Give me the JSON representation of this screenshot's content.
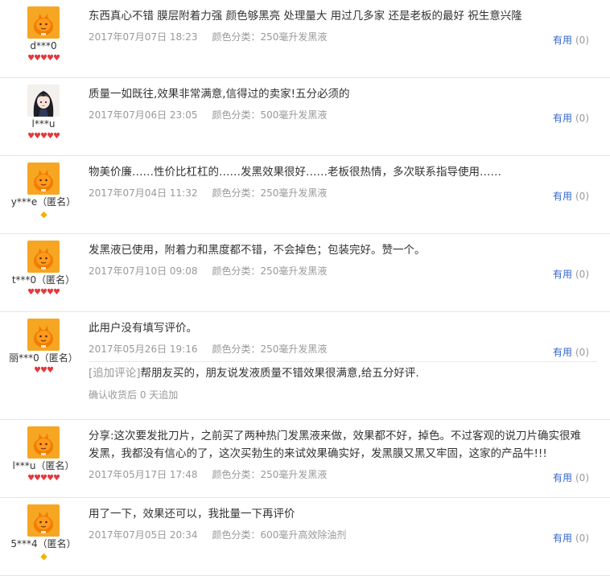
{
  "useful_label": "有用",
  "colors": {
    "link": "#3366cc",
    "meta": "#999999",
    "heart": "#e4393c",
    "diamond": "#f0b400"
  },
  "reviews": [
    {
      "user": "d***0",
      "avatar": "taobao-default-avatar",
      "rank_icon": "heart-icon",
      "rank_display": "♥♥♥♥♥",
      "text": "东西真心不错 膜层附着力强 颜色够黑亮 处理量大 用过几多家 还是老板的最好 祝生意兴隆",
      "date": "2017年07月07日 18:23",
      "sku": "颜色分类：250毫升发黑液",
      "useful_count": "(0)"
    },
    {
      "user": "l***u",
      "avatar": "anime-girl-avatar",
      "rank_icon": "heart-icon",
      "rank_display": "♥♥♥♥♥",
      "text": "质量一如既往,效果非常满意,信得过的卖家!五分必须的",
      "date": "2017年07月06日 23:05",
      "sku": "颜色分类：500毫升发黑液",
      "useful_count": "(0)"
    },
    {
      "user": "y***e（匿名）",
      "avatar": "taobao-default-avatar",
      "rank_icon": "diamond-icon",
      "rank_display": "◆",
      "text": "物美价廉……性价比杠杠的……发黑效果很好……老板很热情，多次联系指导使用……",
      "date": "2017年07月04日 11:32",
      "sku": "颜色分类：250毫升发黑液",
      "useful_count": "(0)"
    },
    {
      "user": "t***0（匿名）",
      "avatar": "taobao-default-avatar",
      "rank_icon": "heart-icon",
      "rank_display": "♥♥♥♥♥",
      "text": "发黑液已使用，附着力和黑度都不错，不会掉色；包装完好。赞一个。",
      "date": "2017年07月10日 09:08",
      "sku": "颜色分类：250毫升发黑液",
      "useful_count": "(0)"
    },
    {
      "user": "丽***0（匿名）",
      "avatar": "taobao-default-avatar",
      "rank_icon": "heart-icon",
      "rank_display": "♥♥♥",
      "text": "此用户没有填写评价。",
      "date": "2017年05月26日 19:16",
      "sku": "颜色分类：250毫升发黑液",
      "useful_count": "(0)",
      "append_tag": "[追加评论]",
      "append_text": "帮朋友买的，朋友说发液质量不错效果很满意,给五分好评.",
      "append_meta": "确认收货后 0 天追加"
    },
    {
      "user": "l***u（匿名）",
      "avatar": "taobao-default-avatar",
      "rank_icon": "heart-icon",
      "rank_display": "♥♥♥♥♥",
      "text": "分享:这次要发批刀片，之前买了两种热门发黑液来做，效果都不好，掉色。不过客观的说刀片确实很难发黑，我都没有信心的了，这次买勃生的来试效果确实好，发黑膜又黑又牢固，这家的产品牛!!!",
      "date": "2017年05月17日 17:48",
      "sku": "颜色分类：250毫升发黑液",
      "useful_count": "(0)"
    },
    {
      "user": "5***4（匿名）",
      "avatar": "taobao-default-avatar",
      "rank_icon": "diamond-icon",
      "rank_display": "◆",
      "text": "用了一下，效果还可以，我批量一下再评价",
      "date": "2017年07月05日 20:34",
      "sku": "颜色分类：600毫升高效除油剂",
      "useful_count": "(0)"
    }
  ]
}
